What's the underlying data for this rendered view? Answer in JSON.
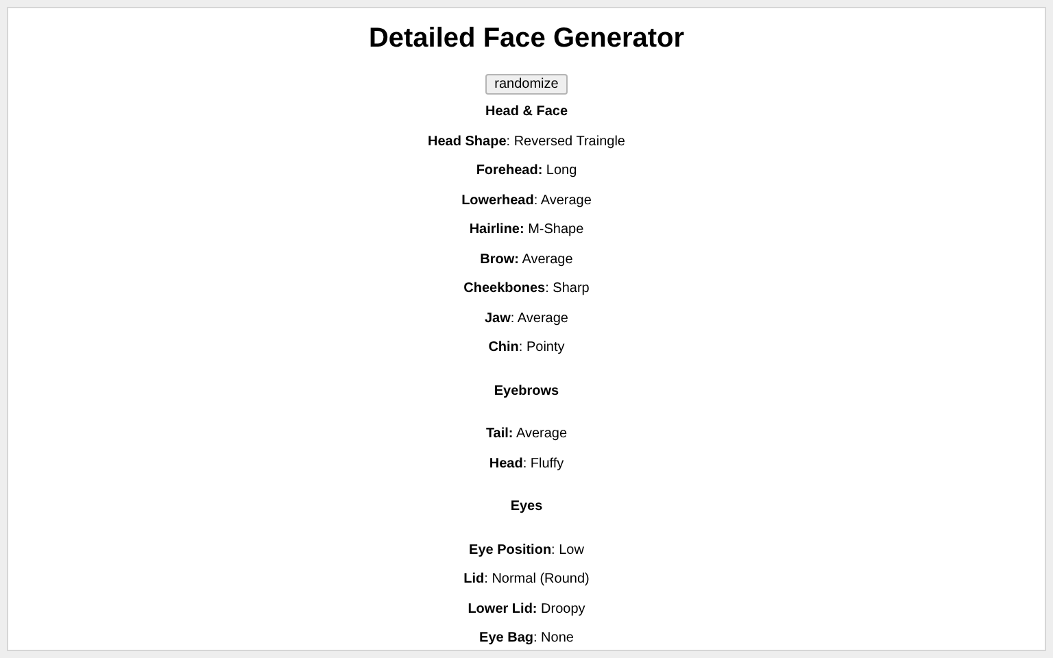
{
  "title": "Detailed Face Generator",
  "button": "randomize",
  "sections": [
    {
      "heading": "Head & Face",
      "rows": [
        "**Head Shape**: Reversed Traingle",
        "**Forehead:** Long",
        "**Lowerhead**: Average",
        "**Hairline:** M-Shape",
        "**Brow:** Average",
        "**Cheekbones**: Sharp",
        "**Jaw**: Average",
        "**Chin**: Pointy"
      ]
    },
    {
      "heading": "Eyebrows",
      "rows": [
        "**Tail:** Average",
        "**Head**: Fluffy"
      ]
    },
    {
      "heading": "Eyes",
      "rows": [
        "**Eye Position**: Low",
        "**Lid**: Normal (Round)",
        "**Lower Lid:** Droopy",
        "**Eye Bag**: None"
      ]
    }
  ]
}
